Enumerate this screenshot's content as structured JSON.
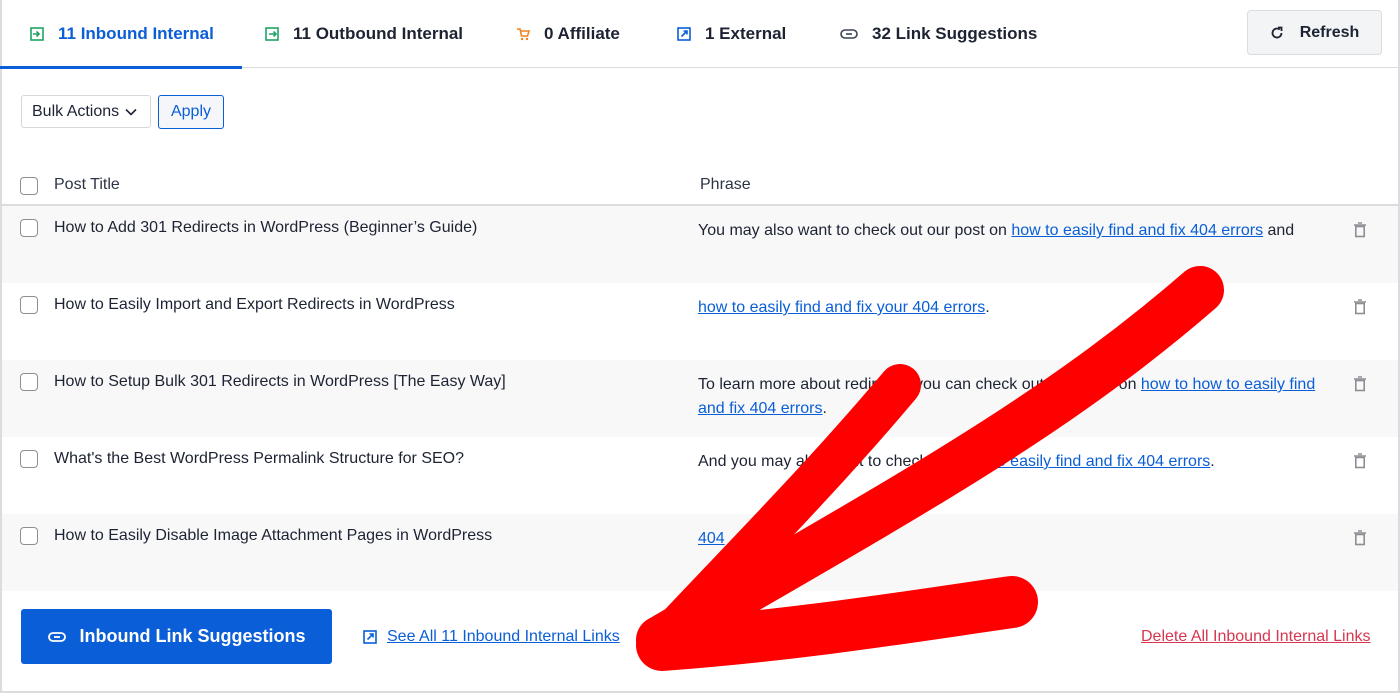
{
  "tabs": [
    {
      "label": "11 Inbound Internal",
      "icon": "inbound-icon",
      "active": true
    },
    {
      "label": "11 Outbound Internal",
      "icon": "outbound-icon",
      "active": false
    },
    {
      "label": "0 Affiliate",
      "icon": "cart-icon",
      "active": false
    },
    {
      "label": "1 External",
      "icon": "external-link-icon",
      "active": false
    },
    {
      "label": "32 Link Suggestions",
      "icon": "link-icon",
      "active": false
    }
  ],
  "refresh_label": "Refresh",
  "bulk_actions": {
    "selected": "Bulk Actions",
    "apply_label": "Apply"
  },
  "table": {
    "columns": [
      "Post Title",
      "Phrase"
    ],
    "rows": [
      {
        "title": "How to Add 301 Redirects in WordPress (Beginner’s Guide)",
        "phrase_pre": "You may also want to check out our post on ",
        "phrase_link": "how to easily find and fix 404 errors",
        "phrase_post": " and"
      },
      {
        "title": "How to Easily Import and Export Redirects in WordPress",
        "phrase_pre": "",
        "phrase_link": "how to easily find and fix your 404 errors",
        "phrase_post": "."
      },
      {
        "title": "How to Setup Bulk 301 Redirects in WordPress [The Easy Way]",
        "phrase_pre": "To learn more about redirects, you can check out our posts on ",
        "phrase_link": "how to how to easily find and fix 404 errors",
        "phrase_post": "."
      },
      {
        "title": "What's the Best WordPress Permalink Structure for SEO?",
        "phrase_pre": "And you may also want to check out ",
        "phrase_link": "how to easily find and fix 404 errors",
        "phrase_post": "."
      },
      {
        "title": "How to Easily Disable Image Attachment Pages in WordPress",
        "phrase_pre": "",
        "phrase_link": "404",
        "phrase_post": ""
      }
    ]
  },
  "footer": {
    "primary_label": "Inbound Link Suggestions",
    "see_all_label": "See All 11 Inbound Internal Links",
    "delete_all_label": "Delete All Inbound Internal Links"
  },
  "colors": {
    "accent": "#0a5ed7",
    "danger": "#d63650",
    "inbound_icon": "#1fa463",
    "affiliate_icon": "#f0831e",
    "annotation": "#ff0000"
  }
}
